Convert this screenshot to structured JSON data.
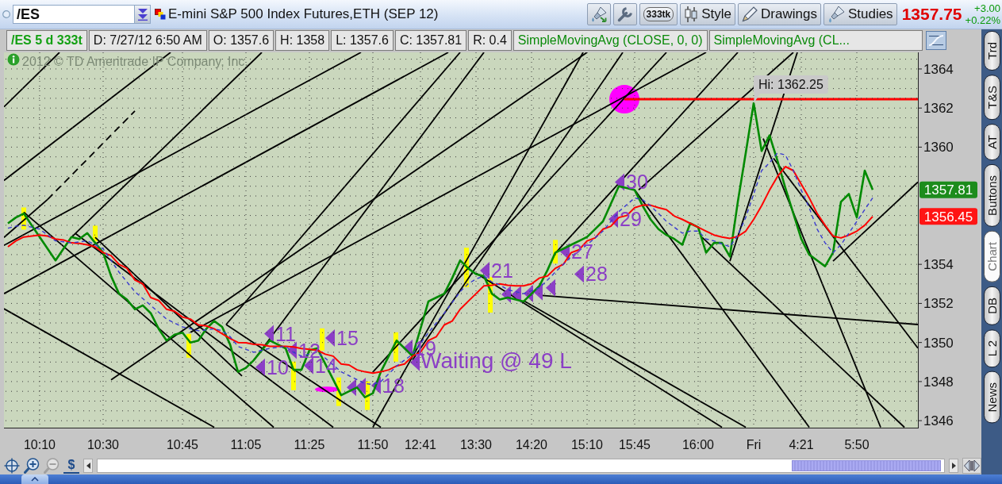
{
  "toolbar": {
    "symbol": "/ES",
    "title": "E-mini S&P 500 Index Futures,ETH (SEP 12)",
    "buttons": [
      {
        "kind": "brush"
      },
      {
        "kind": "wrench"
      },
      {
        "kind": "pill",
        "label": "333tk"
      },
      {
        "kind": "style",
        "label": "Style"
      },
      {
        "kind": "drawings",
        "label": "Drawings"
      },
      {
        "kind": "studies",
        "label": "Studies"
      }
    ],
    "last_price": "1357.75",
    "change": "+3.00",
    "change_percent": "+0.22%"
  },
  "info_bar": [
    {
      "kind": "symbol",
      "text": "/ES 5 d 333t"
    },
    {
      "kind": "field",
      "text": "D: 7/27/12 6:50 AM"
    },
    {
      "kind": "field",
      "text": "O: 1357.6"
    },
    {
      "kind": "field",
      "text": "H: 1358"
    },
    {
      "kind": "field",
      "text": "L: 1357.6"
    },
    {
      "kind": "field",
      "text": "C: 1357.81"
    },
    {
      "kind": "field",
      "text": "R: 0.4"
    },
    {
      "kind": "study",
      "text": "SimpleMovingAvg (CLOSE, 0, 0)"
    },
    {
      "kind": "study",
      "text": "SimpleMovingAvg (CL..."
    }
  ],
  "chart": {
    "notice": "2012 © TD Ameritrade IP Company, Inc.",
    "chart_data": {
      "type": "line",
      "categories": [
        null,
        null,
        null,
        null,
        "10:10",
        null,
        null,
        null,
        null,
        null,
        null,
        null,
        "10:30",
        null,
        null,
        null,
        null,
        null,
        null,
        null,
        null,
        null,
        "10:45",
        null,
        null,
        null,
        null,
        null,
        null,
        null,
        "11:05",
        null,
        null,
        null,
        null,
        null,
        null,
        null,
        "11:25",
        null,
        null,
        null,
        null,
        null,
        null,
        null,
        "11:50",
        null,
        null,
        null,
        null,
        null,
        "12:41",
        null,
        null,
        null,
        null,
        null,
        null,
        "13:30",
        null,
        null,
        null,
        null,
        null,
        null,
        "14:20",
        null,
        null,
        null,
        null,
        null,
        null,
        "15:10",
        null,
        null,
        null,
        null,
        null,
        "15:45",
        null,
        null,
        null,
        null,
        null,
        null,
        null,
        "16:00",
        null,
        null,
        null,
        null,
        null,
        null,
        "Fri",
        null,
        null,
        null,
        null,
        null,
        "4:21",
        null,
        null,
        null,
        null,
        null,
        null,
        "5:50",
        null,
        null
      ],
      "series": [
        {
          "color": "#008a00",
          "line_style": "solid",
          "values": [
            1356.1,
            1356.4,
            1356.6,
            1356.0,
            1355.4,
            1354.8,
            1354.2,
            1354.8,
            1355.4,
            1355.3,
            1355.6,
            1355.1,
            1354.6,
            1353.4,
            1352.5,
            1352.2,
            1351.7,
            1351.9,
            1351.5,
            1350.7,
            1350.1,
            1350.4,
            1350.5,
            1350.0,
            1350.1,
            1350.7,
            1351.1,
            1350.8,
            1349.9,
            1348.5,
            1348.7,
            1349.1,
            1349.6,
            1350.1,
            1349.9,
            1349.7,
            1348.6,
            1348.6,
            1349.6,
            1349.7,
            1348.9,
            1348.1,
            1347.3,
            1347.5,
            1347.7,
            1347.2,
            1347.4,
            1348.5,
            1349.3,
            1350.1,
            1349.7,
            1349.3,
            1350.7,
            1352.1,
            1352.3,
            1352.5,
            1353.3,
            1354.2,
            1353.8,
            1353.5,
            1353.4,
            1352.5,
            1352.2,
            1352.3,
            1352.2,
            1352.1,
            1352.5,
            1352.9,
            1353.7,
            1354.6,
            1354.8,
            1355.0,
            1355.2,
            1355.4,
            1355.8,
            1356.2,
            1357.1,
            1358.0,
            1357.9,
            1357.8,
            1357.0,
            1356.3,
            1355.8,
            1355.5,
            1355.3,
            1355.0,
            1356.1,
            1355.9,
            1354.6,
            1355.1,
            1355.1,
            1354.4,
            1357.2,
            1359.7,
            1362.25,
            1359.8,
            1360.6,
            1359.3,
            1357.9,
            1356.6,
            1355.3,
            1354.5,
            1354.2,
            1353.9,
            1354.6,
            1357.2,
            1357.6,
            1356.4,
            1358.8,
            1357.81
          ]
        },
        {
          "color": "#ff0000",
          "line_style": "solid",
          "values": [
            1354.9,
            1355.2,
            1355.4,
            1355.45,
            1355.5,
            1355.45,
            1355.3,
            1355.25,
            1355.1,
            1355.07,
            1355.0,
            1354.9,
            1354.6,
            1354.45,
            1354.0,
            1353.8,
            1353.2,
            1353.0,
            1352.3,
            1352.15,
            1351.7,
            1351.6,
            1351.3,
            1351.2,
            1350.9,
            1350.85,
            1350.7,
            1350.45,
            1350.2,
            1350.0,
            1349.98,
            1349.9,
            1349.88,
            1349.8,
            1349.8,
            1349.8,
            1349.77,
            1349.69,
            1349.65,
            1349.6,
            1349.4,
            1349.3,
            1348.9,
            1348.85,
            1348.6,
            1348.5,
            1348.43,
            1348.5,
            1348.6,
            1348.8,
            1348.9,
            1349.3,
            1349.5,
            1350.1,
            1350.3,
            1350.9,
            1351.1,
            1351.7,
            1352.1,
            1352.5,
            1352.9,
            1352.93,
            1353.0,
            1352.93,
            1352.9,
            1352.9,
            1353.0,
            1353.3,
            1353.4,
            1353.8,
            1354.0,
            1354.6,
            1354.75,
            1355.2,
            1355.35,
            1355.8,
            1355.95,
            1356.4,
            1356.5,
            1356.9,
            1357.03,
            1357.03,
            1356.9,
            1356.8,
            1356.47,
            1356.3,
            1356.1,
            1355.9,
            1355.7,
            1355.5,
            1355.4,
            1355.33,
            1355.43,
            1355.7,
            1356.3,
            1357.0,
            1357.8,
            1358.5,
            1359.0,
            1358.8,
            1358.1,
            1357.4,
            1356.6,
            1356.0,
            1355.45,
            1355.35,
            1355.5,
            1355.7,
            1356.0,
            1356.45
          ]
        },
        {
          "color": "#3a3ad0",
          "line_style": "dashed",
          "values": [
            1355.85,
            1355.95,
            1356.0,
            1355.9,
            1355.8,
            1355.5,
            1355.2,
            1355.15,
            1355.1,
            1355.15,
            1355.2,
            1355.0,
            1354.8,
            1354.2,
            1353.6,
            1353.1,
            1352.6,
            1352.25,
            1351.9,
            1351.55,
            1351.2,
            1351.0,
            1350.8,
            1350.7,
            1350.6,
            1350.65,
            1350.7,
            1350.6,
            1350.3,
            1349.8,
            1349.65,
            1349.5,
            1349.6,
            1349.7,
            1349.75,
            1349.8,
            1349.5,
            1349.3,
            1349.4,
            1349.5,
            1349.2,
            1348.85,
            1348.5,
            1348.3,
            1348.1,
            1347.9,
            1347.85,
            1348.0,
            1348.4,
            1348.8,
            1349.1,
            1349.4,
            1349.95,
            1350.5,
            1351.0,
            1351.5,
            1352.05,
            1352.6,
            1353.0,
            1353.25,
            1353.4,
            1353.1,
            1352.95,
            1352.7,
            1352.6,
            1352.5,
            1352.65,
            1352.8,
            1353.2,
            1353.6,
            1354.0,
            1354.4,
            1354.7,
            1355.0,
            1355.35,
            1355.7,
            1356.2,
            1356.7,
            1357.05,
            1357.4,
            1357.3,
            1357.0,
            1356.6,
            1356.2,
            1355.9,
            1355.6,
            1355.7,
            1355.7,
            1355.3,
            1355.2,
            1355.05,
            1354.9,
            1355.5,
            1356.4,
            1357.6,
            1358.8,
            1359.2,
            1359.7,
            1359.6,
            1358.8,
            1357.8,
            1356.9,
            1355.8,
            1355.1,
            1354.6,
            1355.0,
            1355.6,
            1356.2,
            1356.8,
            1357.4
          ]
        }
      ],
      "ylim": [
        1345.6,
        1364.85
      ],
      "yticks": [
        1346,
        1348,
        1350,
        1352,
        1354,
        1360,
        1362,
        1364
      ],
      "grid": true,
      "annotations": [
        "10",
        "11",
        "12",
        "14",
        "15",
        "18",
        "19",
        "21",
        "27",
        "28",
        "29",
        "30",
        "Waiting @ 49 L",
        "Hi: 1362.25"
      ]
    },
    "price_tags": [
      {
        "label": "1357.81",
        "color": "#1c8c1c"
      },
      {
        "label": "1356.45",
        "color": "#ff1414"
      }
    ]
  },
  "side_tabs": [
    {
      "label": "Trd",
      "selected": false
    },
    {
      "label": "T&S",
      "selected": false
    },
    {
      "label": "AT",
      "selected": false
    },
    {
      "label": "Buttons",
      "selected": false
    },
    {
      "label": "Chart",
      "selected": true
    },
    {
      "label": "DB",
      "selected": false
    },
    {
      "label": "L 2",
      "selected": false
    },
    {
      "label": "News",
      "selected": false
    }
  ],
  "bottom_tools": [
    {
      "kind": "crosshair",
      "disabled": false
    },
    {
      "kind": "zoom_in",
      "disabled": false
    },
    {
      "kind": "zoom_out",
      "disabled": true
    },
    {
      "kind": "currency",
      "label": "$",
      "disabled": false
    }
  ]
}
